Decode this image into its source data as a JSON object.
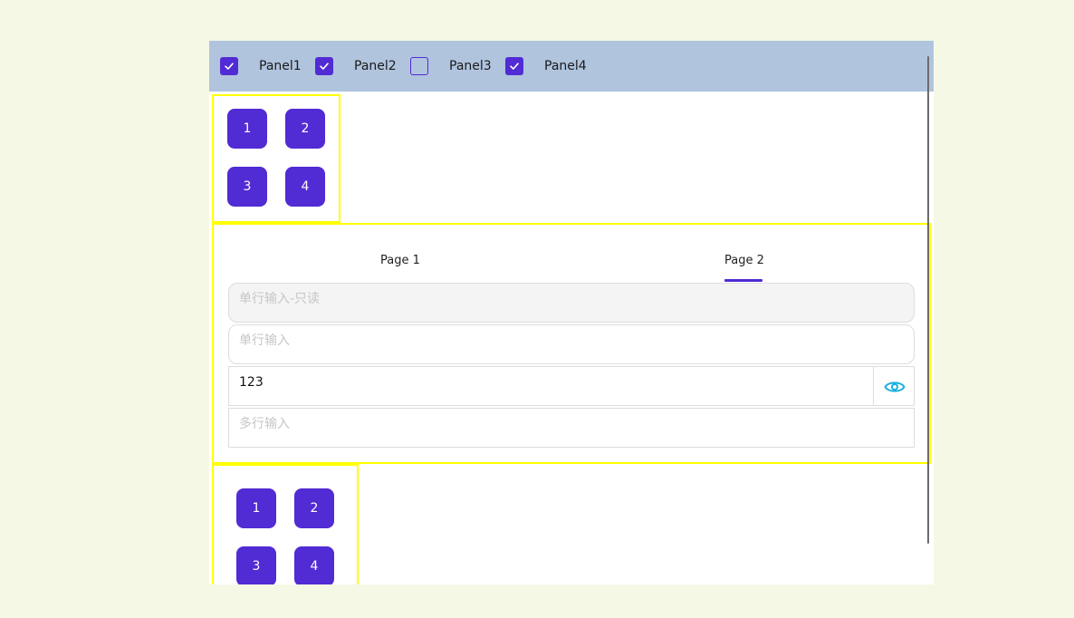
{
  "panels": [
    {
      "label": "Panel1",
      "checked": true
    },
    {
      "label": "Panel2",
      "checked": true
    },
    {
      "label": "Panel3",
      "checked": false
    },
    {
      "label": "Panel4",
      "checked": true
    }
  ],
  "grid_top": {
    "buttons": [
      "1",
      "2",
      "3",
      "4"
    ]
  },
  "tabs": [
    {
      "label": "Page 1",
      "selected": false
    },
    {
      "label": "Page 2",
      "selected": true
    }
  ],
  "form": {
    "readonly_placeholder": "单行输入-只读",
    "single_placeholder": "单行输入",
    "password_value": "123",
    "multiline_placeholder": "多行输入"
  },
  "grid_bottom": {
    "buttons": [
      "1",
      "2",
      "3",
      "4"
    ]
  },
  "icons": {
    "check": "check-icon",
    "show_password": "eye-icon"
  },
  "colors": {
    "accent": "#512bd4",
    "header_bg": "#b0c4de",
    "panel_border": "#ffff00",
    "eye_icon": "#1ab0dd"
  }
}
